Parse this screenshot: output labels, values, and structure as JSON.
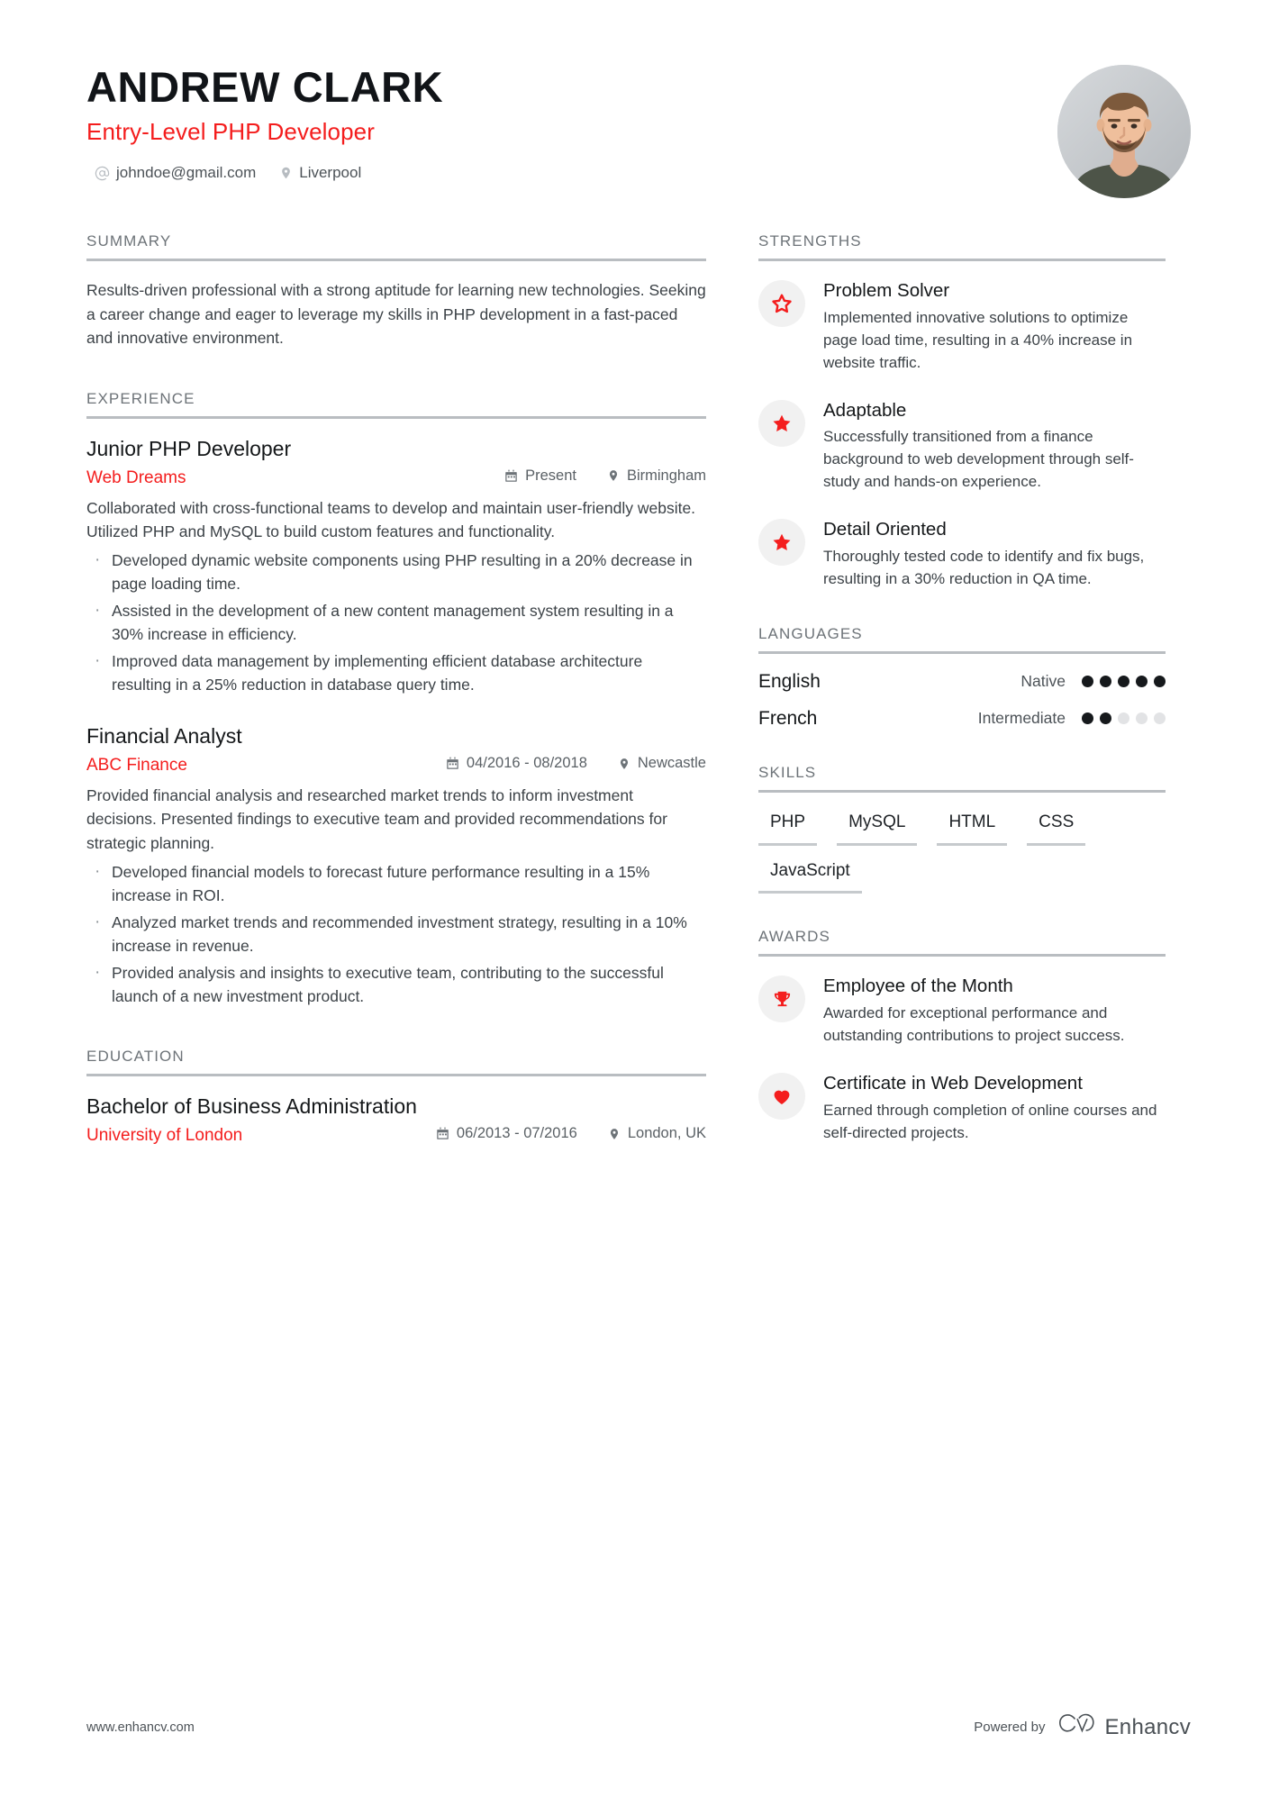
{
  "header": {
    "name": "ANDREW CLARK",
    "title": "Entry-Level PHP Developer",
    "email": "johndoe@gmail.com",
    "location": "Liverpool",
    "email_icon": "at-sign-icon",
    "location_icon": "map-pin-icon",
    "avatar_alt": "profile-photo"
  },
  "sections": {
    "summary_title": "SUMMARY",
    "experience_title": "EXPERIENCE",
    "education_title": "EDUCATION",
    "strengths_title": "STRENGTHS",
    "languages_title": "LANGUAGES",
    "skills_title": "SKILLS",
    "awards_title": "AWARDS"
  },
  "summary": {
    "text": "Results-driven professional with a strong aptitude for learning new technologies. Seeking a career change and eager to leverage my skills in PHP development in a fast-paced and innovative environment."
  },
  "experience": [
    {
      "title": "Junior PHP Developer",
      "organization": "Web Dreams",
      "dates": "Present",
      "location": "Birmingham",
      "description": "Collaborated with cross-functional teams to develop and maintain user-friendly website. Utilized PHP and MySQL to build custom features and functionality.",
      "bullets": [
        "Developed dynamic website components using PHP resulting in a 20% decrease in page loading time.",
        "Assisted in the development of a new content management system resulting in a 30% increase in efficiency.",
        "Improved data management by implementing efficient database architecture resulting in a 25% reduction in database query time."
      ]
    },
    {
      "title": "Financial Analyst",
      "organization": "ABC Finance",
      "dates": "04/2016 - 08/2018",
      "location": "Newcastle",
      "description": "Provided financial analysis and researched market trends to inform investment decisions. Presented findings to executive team and provided recommendations for strategic planning.",
      "bullets": [
        "Developed financial models to forecast future performance resulting in a 15% increase in ROI.",
        "Analyzed market trends and recommended investment strategy, resulting in a 10% increase in revenue.",
        "Provided analysis and insights to executive team, contributing to the successful launch of a new investment product."
      ]
    }
  ],
  "education": [
    {
      "title": "Bachelor of Business Administration",
      "organization": "University of London",
      "dates": "06/2013 - 07/2016",
      "location": "London, UK"
    }
  ],
  "strengths": [
    {
      "icon": "star-outline-icon",
      "title": "Problem Solver",
      "description": "Implemented innovative solutions to optimize page load time, resulting in a 40% increase in website traffic."
    },
    {
      "icon": "star-filled-icon",
      "title": "Adaptable",
      "description": "Successfully transitioned from a finance background to web development through self-study and hands-on experience."
    },
    {
      "icon": "star-filled-icon",
      "title": "Detail Oriented",
      "description": "Thoroughly tested code to identify and fix bugs, resulting in a 30% reduction in QA time."
    }
  ],
  "languages": [
    {
      "name": "English",
      "level": "Native",
      "filled": 5,
      "total": 5
    },
    {
      "name": "French",
      "level": "Intermediate",
      "filled": 2,
      "total": 5
    }
  ],
  "skills": [
    "PHP",
    "MySQL",
    "HTML",
    "CSS",
    "JavaScript"
  ],
  "awards": [
    {
      "icon": "trophy-icon",
      "title": "Employee of the Month",
      "description": "Awarded for exceptional performance and outstanding contributions to project success."
    },
    {
      "icon": "heart-icon",
      "title": "Certificate in Web Development",
      "description": "Earned through completion of online courses and self-directed projects."
    }
  ],
  "footer": {
    "url": "www.enhancv.com",
    "powered_by": "Powered by",
    "brand": "Enhancv",
    "brand_icon": "enhancv-logo-icon"
  },
  "colors": {
    "accent": "#f41d1d",
    "heading": "#6d7378",
    "text": "#3c4247",
    "rule": "#b9bdc1"
  }
}
